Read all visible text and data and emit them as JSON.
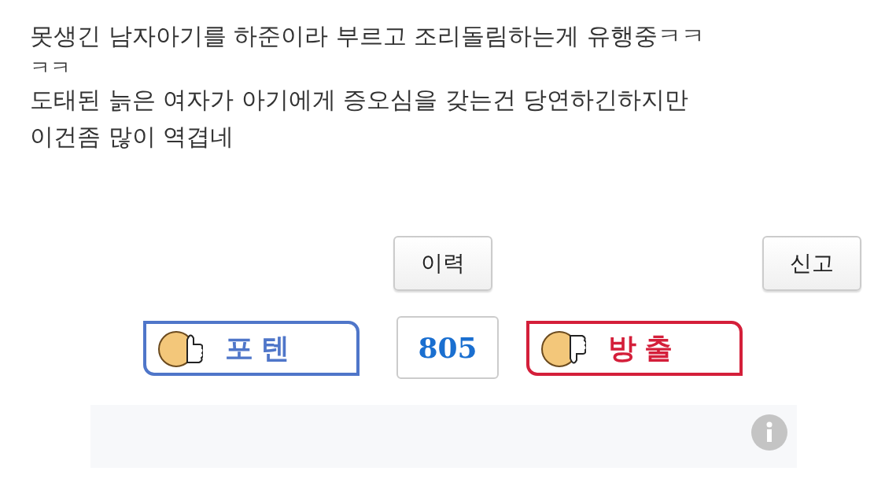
{
  "post": {
    "lines": [
      "못생긴 남자아기를 하준이라 부르고 조리돌림하는게 유행중ㅋㅋ",
      "ㅋㅋ",
      "도태된 늙은 여자가 아기에게 증오심을 갖는건 당연하긴하지만",
      "이건좀 많이 역겹네"
    ]
  },
  "actions": [
    {
      "kind": "history",
      "label": "이력"
    },
    {
      "kind": "report",
      "label": "신고"
    }
  ],
  "votes": {
    "up": {
      "label": "포텐",
      "color": "#4f76c9"
    },
    "count": "805",
    "down": {
      "label": "방출",
      "color": "#d41f3a"
    }
  },
  "ad": {
    "kind": "placeholder"
  }
}
